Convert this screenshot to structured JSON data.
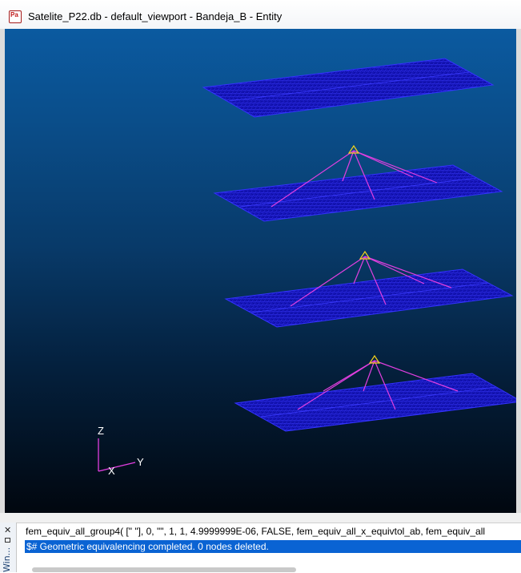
{
  "window": {
    "title": "Satelite_P22.db - default_viewport - Bandeja_B - Entity",
    "icon": "patran-app-icon",
    "icon_text": "Pa"
  },
  "viewport": {
    "background_top": "#0b5aa0",
    "background_bottom": "#01070f",
    "mesh_color": "#1c1ccf",
    "rbe_color": "#e23fe0",
    "triad": {
      "z": "Z",
      "y": "Y",
      "x": "X"
    }
  },
  "command_panel": {
    "side_label": "Win...",
    "history_line": "fem_equiv_all_group4( [\" \"], 0, \"\", 1, 1, 4.9999999E-06, FALSE, fem_equiv_all_x_equivtol_ab, fem_equiv_all",
    "status_line": "$# Geometric equivalencing completed. 0 nodes deleted."
  }
}
